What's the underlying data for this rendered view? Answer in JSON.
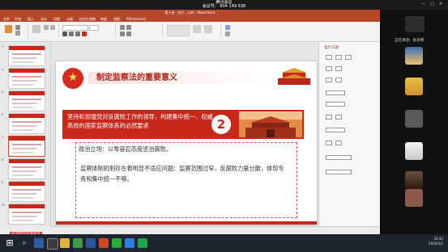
{
  "meeting": {
    "app_title": "腾讯会议",
    "meeting_label": "会议号：",
    "meeting_id": "804 149 638",
    "share_label": "张沛博的屏幕共享"
  },
  "ppt": {
    "window_title": "第十讲 - 关于…公约 - PowerPoint",
    "tabs": [
      "文件",
      "开始",
      "插入",
      "设计",
      "切换",
      "动画",
      "幻灯片放映",
      "审阅",
      "视图",
      "PDFelement"
    ],
    "slide": {
      "heading": "制定监察法的重要意义",
      "banner_text": "坚持和加强党对反腐败工作的领导，构建集中统一、权威高效的国家监察体系的必然要求",
      "number": "2",
      "para1": "政治立场：以零容忍态度惩治腐败。",
      "para2": "监察体制机制存在着明显不适应问题：监察范围过窄，反腐败力量分散，体现专责和集中统一不够。"
    },
    "format_pane_title": "设计工具",
    "thumb_numbers": [
      "3",
      "4",
      "5",
      "6",
      "7",
      "8",
      "9",
      "10"
    ]
  },
  "participants": {
    "header": "正在讲话：张洋博"
  },
  "taskbar": {
    "time": "20:42",
    "date": "2020/4/2"
  },
  "colors": {
    "ppt_accent": "#b7472a",
    "slide_red": "#c8281c",
    "taskbar_bg": "#1e2430"
  }
}
